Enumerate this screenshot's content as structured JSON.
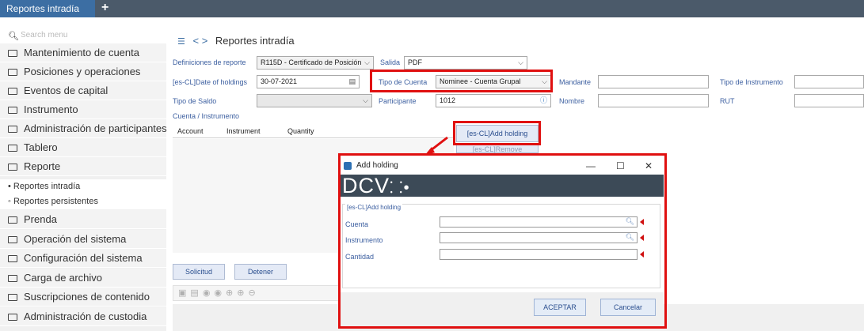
{
  "topbar": {
    "tab_label": "Reportes intradía",
    "add_tab": "+"
  },
  "sidebar": {
    "search_placeholder": "Search menu",
    "items": [
      {
        "label": "Mantenimiento de cuenta"
      },
      {
        "label": "Posiciones y operaciones"
      },
      {
        "label": "Eventos de capital"
      },
      {
        "label": "Instrumento"
      },
      {
        "label": "Administración de participantes"
      },
      {
        "label": "Tablero"
      },
      {
        "label": "Reporte"
      }
    ],
    "sub_items": [
      {
        "label": "Reportes intradía",
        "bullet": "•"
      },
      {
        "label": "Reportes persistentes",
        "bullet": "◦"
      }
    ],
    "items_after": [
      {
        "label": "Prenda"
      },
      {
        "label": "Operación del sistema"
      },
      {
        "label": "Configuración del sistema"
      },
      {
        "label": "Carga de archivo"
      },
      {
        "label": "Suscripciones de contenido"
      },
      {
        "label": "Administración de custodia"
      }
    ]
  },
  "header": {
    "nav": "< >",
    "title": "Reportes intradía"
  },
  "form": {
    "def_label": "Definiciones de reporte",
    "def_value": "R115D - Certificado de Posición",
    "salida_label": "Salida",
    "salida_value": "PDF",
    "date_label": "[es-CL]Date of holdings",
    "date_value": "30-07-2021",
    "tipo_cuenta_label": "Tipo de Cuenta",
    "tipo_cuenta_value": "Nominee - Cuenta Grupal",
    "mandante_label": "Mandante",
    "tipo_instr_label": "Tipo de Instrumento",
    "tipo_saldo_label": "Tipo de Saldo",
    "participante_label": "Participante",
    "participante_value": "1012",
    "nombre_label": "Nombre",
    "rut_label": "RUT",
    "cuenta_instr_label": "Cuenta / Instrumento"
  },
  "table": {
    "columns": [
      "Account",
      "Instrument",
      "Quantity"
    ]
  },
  "buttons": {
    "add_holding": "[es-CL]Add holding",
    "remove": "[es-CL]Remove",
    "solicitud": "Solicitud",
    "detener": "Detener"
  },
  "dialog": {
    "title": "Add holding",
    "logo": "DCV",
    "minimize": "—",
    "maximize": "☐",
    "close": "✕",
    "legend": "[es-CL]Add holding",
    "cuenta_label": "Cuenta",
    "instrumento_label": "Instrumento",
    "cantidad_label": "Cantidad",
    "accept": "ACEPTAR",
    "cancel": "Cancelar"
  },
  "colors": {
    "highlight": "#e01010",
    "accent": "#3c6ea3",
    "topbar": "#4b5a6a"
  },
  "icons": [
    "search-icon",
    "folder-icon",
    "sitemap-icon",
    "chevron-left-icon",
    "chevron-right-icon",
    "calendar-icon",
    "info-icon",
    "magnifier-icon",
    "app-icon"
  ]
}
